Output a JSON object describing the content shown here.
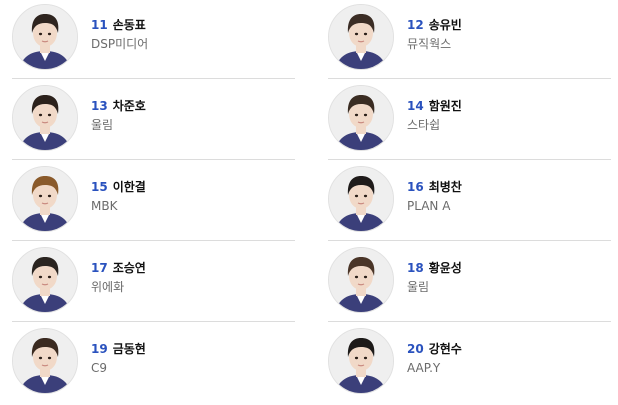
{
  "colors": {
    "number": "#2a52be",
    "name": "#111111",
    "agency": "#6b6b6b",
    "divider": "#dcdcdc",
    "uniform": "#3b3f7a",
    "skin": "#f1d9c8"
  },
  "trainees": [
    {
      "number": "11",
      "name": "손동표",
      "agency": "DSP미디어",
      "hair": "#2e241f"
    },
    {
      "number": "12",
      "name": "송유빈",
      "agency": "뮤직웍스",
      "hair": "#3b2d25"
    },
    {
      "number": "13",
      "name": "차준호",
      "agency": "울림",
      "hair": "#2b211b"
    },
    {
      "number": "14",
      "name": "함원진",
      "agency": "스타쉽",
      "hair": "#3a2c22"
    },
    {
      "number": "15",
      "name": "이한결",
      "agency": "MBK",
      "hair": "#8a5a2b"
    },
    {
      "number": "16",
      "name": "최병찬",
      "agency": "PLAN A",
      "hair": "#1f1b1a"
    },
    {
      "number": "17",
      "name": "조승연",
      "agency": "위에화",
      "hair": "#2a2420"
    },
    {
      "number": "18",
      "name": "황윤성",
      "agency": "울림",
      "hair": "#4a3528"
    },
    {
      "number": "19",
      "name": "금동현",
      "agency": "C9",
      "hair": "#3a2a20"
    },
    {
      "number": "20",
      "name": "강현수",
      "agency": "AAP.Y",
      "hair": "#1d1a19"
    }
  ]
}
